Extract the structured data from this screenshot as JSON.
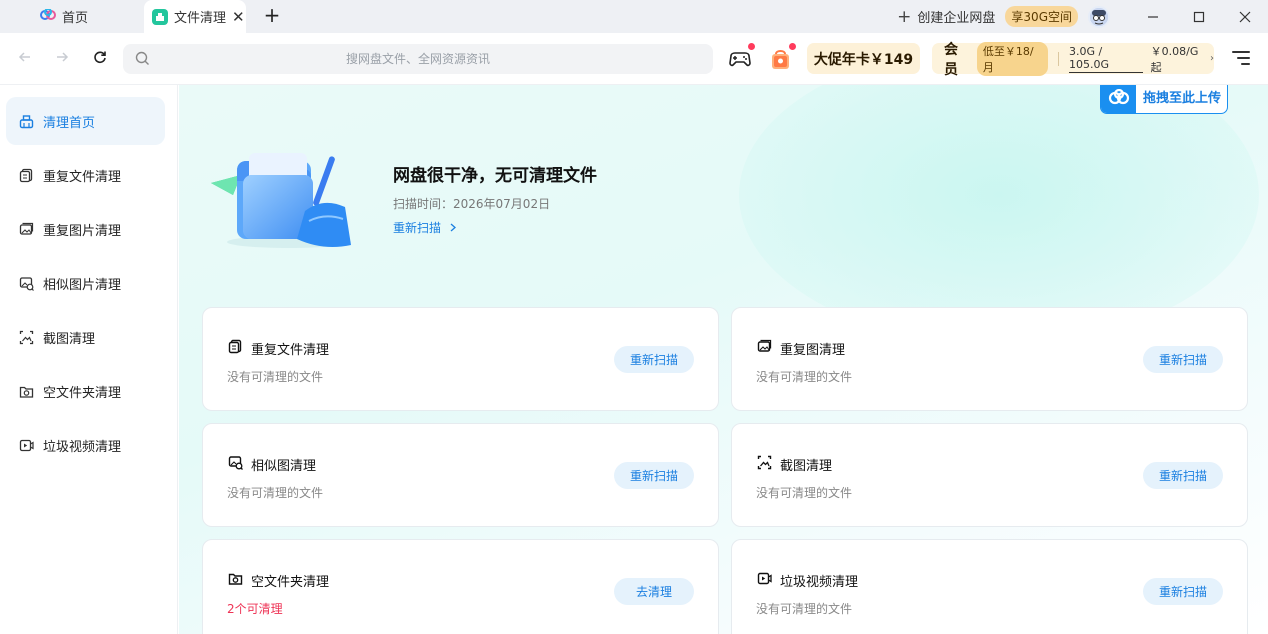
{
  "titlebar": {
    "tabs": [
      {
        "label": "首页",
        "icon": "baidu-netdisk-logo-icon"
      },
      {
        "label": "文件清理",
        "icon": "clean-app-icon"
      }
    ],
    "new_tab_icon": "plus-icon",
    "create_enterprise": "创建企业网盘",
    "promo_pill": "享30G空间",
    "window_controls": [
      "minimize-icon",
      "maximize-icon",
      "close-icon"
    ]
  },
  "toolbar": {
    "search_placeholder": "搜网盘文件、全网资源资讯",
    "year_card": "大促年卡￥149",
    "vip": {
      "label": "会员",
      "price_pill": "低至￥18/月",
      "storage": "3.0G / 105.0G",
      "unit_price": "￥0.08/G起"
    }
  },
  "sidebar": {
    "items": [
      {
        "label": "清理首页",
        "icon": "broom-basket-icon",
        "active": true
      },
      {
        "label": "重复文件清理",
        "icon": "duplicate-file-icon",
        "active": false
      },
      {
        "label": "重复图片清理",
        "icon": "duplicate-image-icon",
        "active": false
      },
      {
        "label": "相似图片清理",
        "icon": "similar-image-icon",
        "active": false
      },
      {
        "label": "截图清理",
        "icon": "screenshot-icon",
        "active": false
      },
      {
        "label": "空文件夹清理",
        "icon": "empty-folder-icon",
        "active": false
      },
      {
        "label": "垃圾视频清理",
        "icon": "video-icon",
        "active": false
      }
    ]
  },
  "main": {
    "drag_upload": "拖拽至此上传",
    "hero": {
      "title": "网盘很干净，无可清理文件",
      "scan_time": "扫描时间：2026年07月02日",
      "rescan": "重新扫描"
    },
    "cards": [
      {
        "title": "重复文件清理",
        "sub": "没有可清理的文件",
        "button": "重新扫描",
        "alert": false,
        "icon": "duplicate-file-icon"
      },
      {
        "title": "重复图清理",
        "sub": "没有可清理的文件",
        "button": "重新扫描",
        "alert": false,
        "icon": "duplicate-image-icon"
      },
      {
        "title": "相似图清理",
        "sub": "没有可清理的文件",
        "button": "重新扫描",
        "alert": false,
        "icon": "similar-image-icon"
      },
      {
        "title": "截图清理",
        "sub": "没有可清理的文件",
        "button": "重新扫描",
        "alert": false,
        "icon": "screenshot-icon"
      },
      {
        "title": "空文件夹清理",
        "sub": "2个可清理",
        "button": "去清理",
        "alert": true,
        "icon": "empty-folder-icon"
      },
      {
        "title": "垃圾视频清理",
        "sub": "没有可清理的文件",
        "button": "重新扫描",
        "alert": false,
        "icon": "video-icon"
      }
    ]
  },
  "colors": {
    "accent": "#1a7fe0",
    "alert": "#ee3355",
    "app_badge": "#23c69d",
    "vip_bg": "#fdf3dc"
  }
}
